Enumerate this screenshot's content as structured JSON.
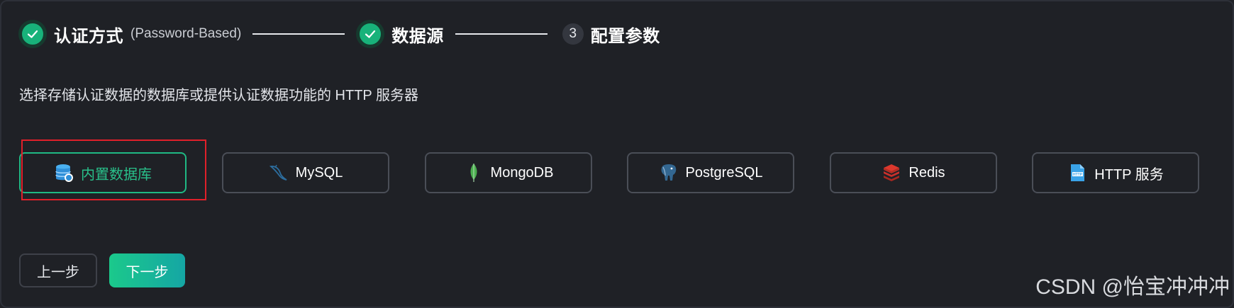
{
  "stepper": {
    "step1": {
      "title": "认证方式",
      "subtitle": "(Password-Based)"
    },
    "step2": {
      "title": "数据源"
    },
    "step3": {
      "number": "3",
      "title": "配置参数"
    }
  },
  "description": "选择存储认证数据的数据库或提供认证数据功能的 HTTP 服务器",
  "sources": [
    {
      "label": "内置数据库",
      "icon": "builtin-database-icon",
      "selected": true
    },
    {
      "label": "MySQL",
      "icon": "mysql-dolphin-icon"
    },
    {
      "label": "MongoDB",
      "icon": "mongodb-leaf-icon"
    },
    {
      "label": "PostgreSQL",
      "icon": "postgresql-elephant-icon"
    },
    {
      "label": "Redis",
      "icon": "redis-icon"
    },
    {
      "label": "HTTP 服务",
      "icon": "http-file-icon"
    }
  ],
  "buttons": {
    "prev": "上一步",
    "next": "下一步"
  },
  "watermark": "CSDN @怡宝冲冲冲",
  "colors": {
    "accent": "#1fb984",
    "highlight": "#e0202a",
    "background": "#1f2126"
  }
}
